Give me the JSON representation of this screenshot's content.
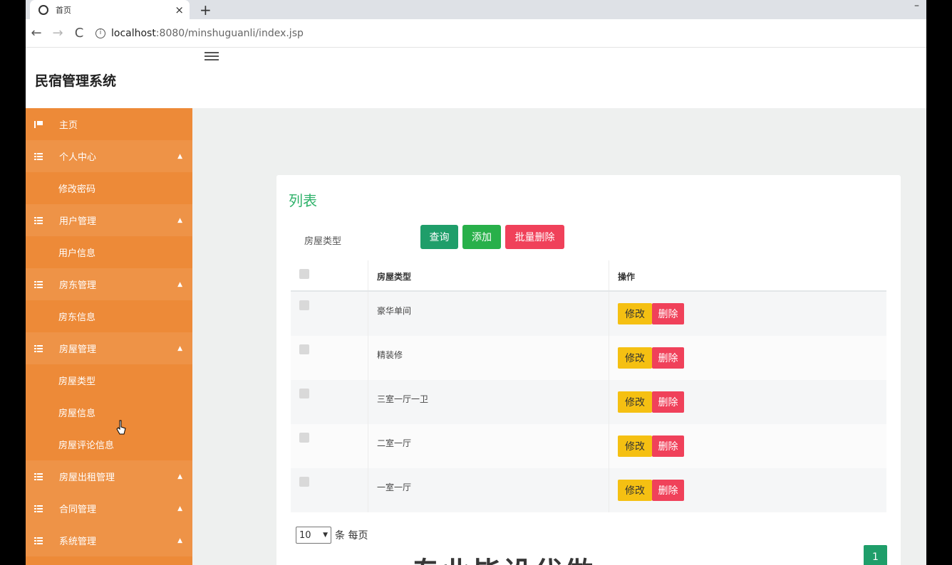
{
  "browser": {
    "tab_title": "首页",
    "tab_close": "×",
    "new_tab": "+",
    "win_min": "–",
    "back": "←",
    "forward": "→",
    "reload": "C",
    "url_host": "localhost",
    "url_rest": ":8080/minshuguanli/index.jsp"
  },
  "app": {
    "brand": "民宿管理系统"
  },
  "sidebar": {
    "items": [
      {
        "label": "主页",
        "type": "top"
      },
      {
        "label": "个人中心",
        "type": "group"
      },
      {
        "label": "修改密码",
        "type": "sub"
      },
      {
        "label": "用户管理",
        "type": "group"
      },
      {
        "label": "用户信息",
        "type": "sub"
      },
      {
        "label": "房东管理",
        "type": "group"
      },
      {
        "label": "房东信息",
        "type": "sub"
      },
      {
        "label": "房屋管理",
        "type": "group"
      },
      {
        "label": "房屋类型",
        "type": "sub"
      },
      {
        "label": "房屋信息",
        "type": "sub"
      },
      {
        "label": "房屋评论信息",
        "type": "sub"
      },
      {
        "label": "房屋出租管理",
        "type": "group"
      },
      {
        "label": "合同管理",
        "type": "group"
      },
      {
        "label": "系统管理",
        "type": "group"
      }
    ]
  },
  "main": {
    "title": "列表",
    "search_label": "房屋类型",
    "buttons": {
      "query": "查询",
      "add": "添加",
      "batch_delete": "批量删除"
    },
    "table": {
      "headers": [
        "房屋类型",
        "操作"
      ],
      "rows": [
        "豪华单间",
        "精装修",
        "三室一厅一卫",
        "二室一厅",
        "一室一厅"
      ],
      "edit_label": "修改",
      "delete_label": "删除"
    },
    "page_size": "10",
    "page_size_suffix": "条 每页",
    "current_page": "1",
    "watermark": "专业毕设代做"
  }
}
